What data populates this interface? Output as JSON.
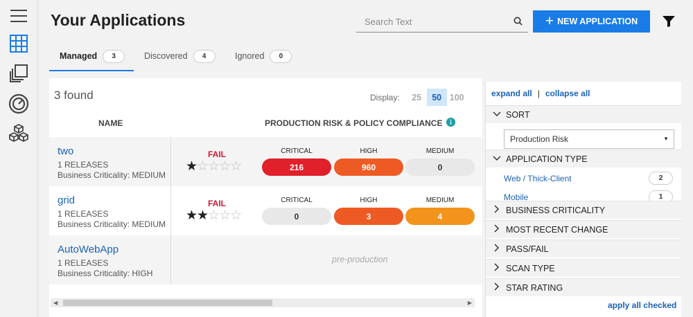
{
  "header": {
    "title": "Your Applications",
    "search_placeholder": "Search Text",
    "new_app_label": "NEW APPLICATION"
  },
  "rail": {
    "icons": [
      "menu-icon",
      "grid-icon",
      "copy-icon",
      "dashboard-icon",
      "cubes-icon"
    ]
  },
  "tabs": [
    {
      "label": "Managed",
      "count": "3"
    },
    {
      "label": "Discovered",
      "count": "4"
    },
    {
      "label": "Ignored",
      "count": "0"
    }
  ],
  "main": {
    "found": "3 found",
    "display_label": "Display:",
    "display_options": [
      "25",
      "50",
      "100"
    ],
    "display_selected": "50",
    "col_name": "NAME",
    "col_risk": "PRODUCTION RISK & POLICY COMPLIANCE",
    "severity_labels": [
      "CRITICAL",
      "HIGH",
      "MEDIUM"
    ],
    "apps": [
      {
        "name": "two",
        "releases": "1 RELEASES",
        "criticality": "Business Criticality: MEDIUM",
        "status": "FAIL",
        "stars": 1,
        "critical": "216",
        "high": "960",
        "medium": "0"
      },
      {
        "name": "grid",
        "releases": "1 RELEASES",
        "criticality": "Business Criticality: MEDIUM",
        "status": "FAIL",
        "stars": 2,
        "critical": "0",
        "high": "3",
        "medium": "4"
      },
      {
        "name": "AutoWebApp",
        "releases": "1 RELEASES",
        "criticality": "Business Criticality: HIGH",
        "preprod": "pre-production"
      }
    ]
  },
  "filters": {
    "expand_all": "expand all",
    "separator": "|",
    "collapse_all": "collapse all",
    "sort_title": "SORT",
    "sort_value": "Production Risk",
    "app_type_title": "APPLICATION TYPE",
    "app_types": [
      {
        "label": "Web / Thick-Client",
        "count": "2"
      },
      {
        "label": "Mobile",
        "count": "1"
      }
    ],
    "sections": [
      "BUSINESS CRITICALITY",
      "MOST RECENT CHANGE",
      "PASS/FAIL",
      "SCAN TYPE",
      "STAR RATING"
    ],
    "apply": "apply all checked"
  },
  "colors": {
    "accent": "#1a7ce6",
    "link": "#1a62b8",
    "fail": "#d0183a",
    "critical": "#e0202a",
    "high": "#ee5a24",
    "medium": "#f2931b",
    "zero": "#e8e8e8"
  }
}
